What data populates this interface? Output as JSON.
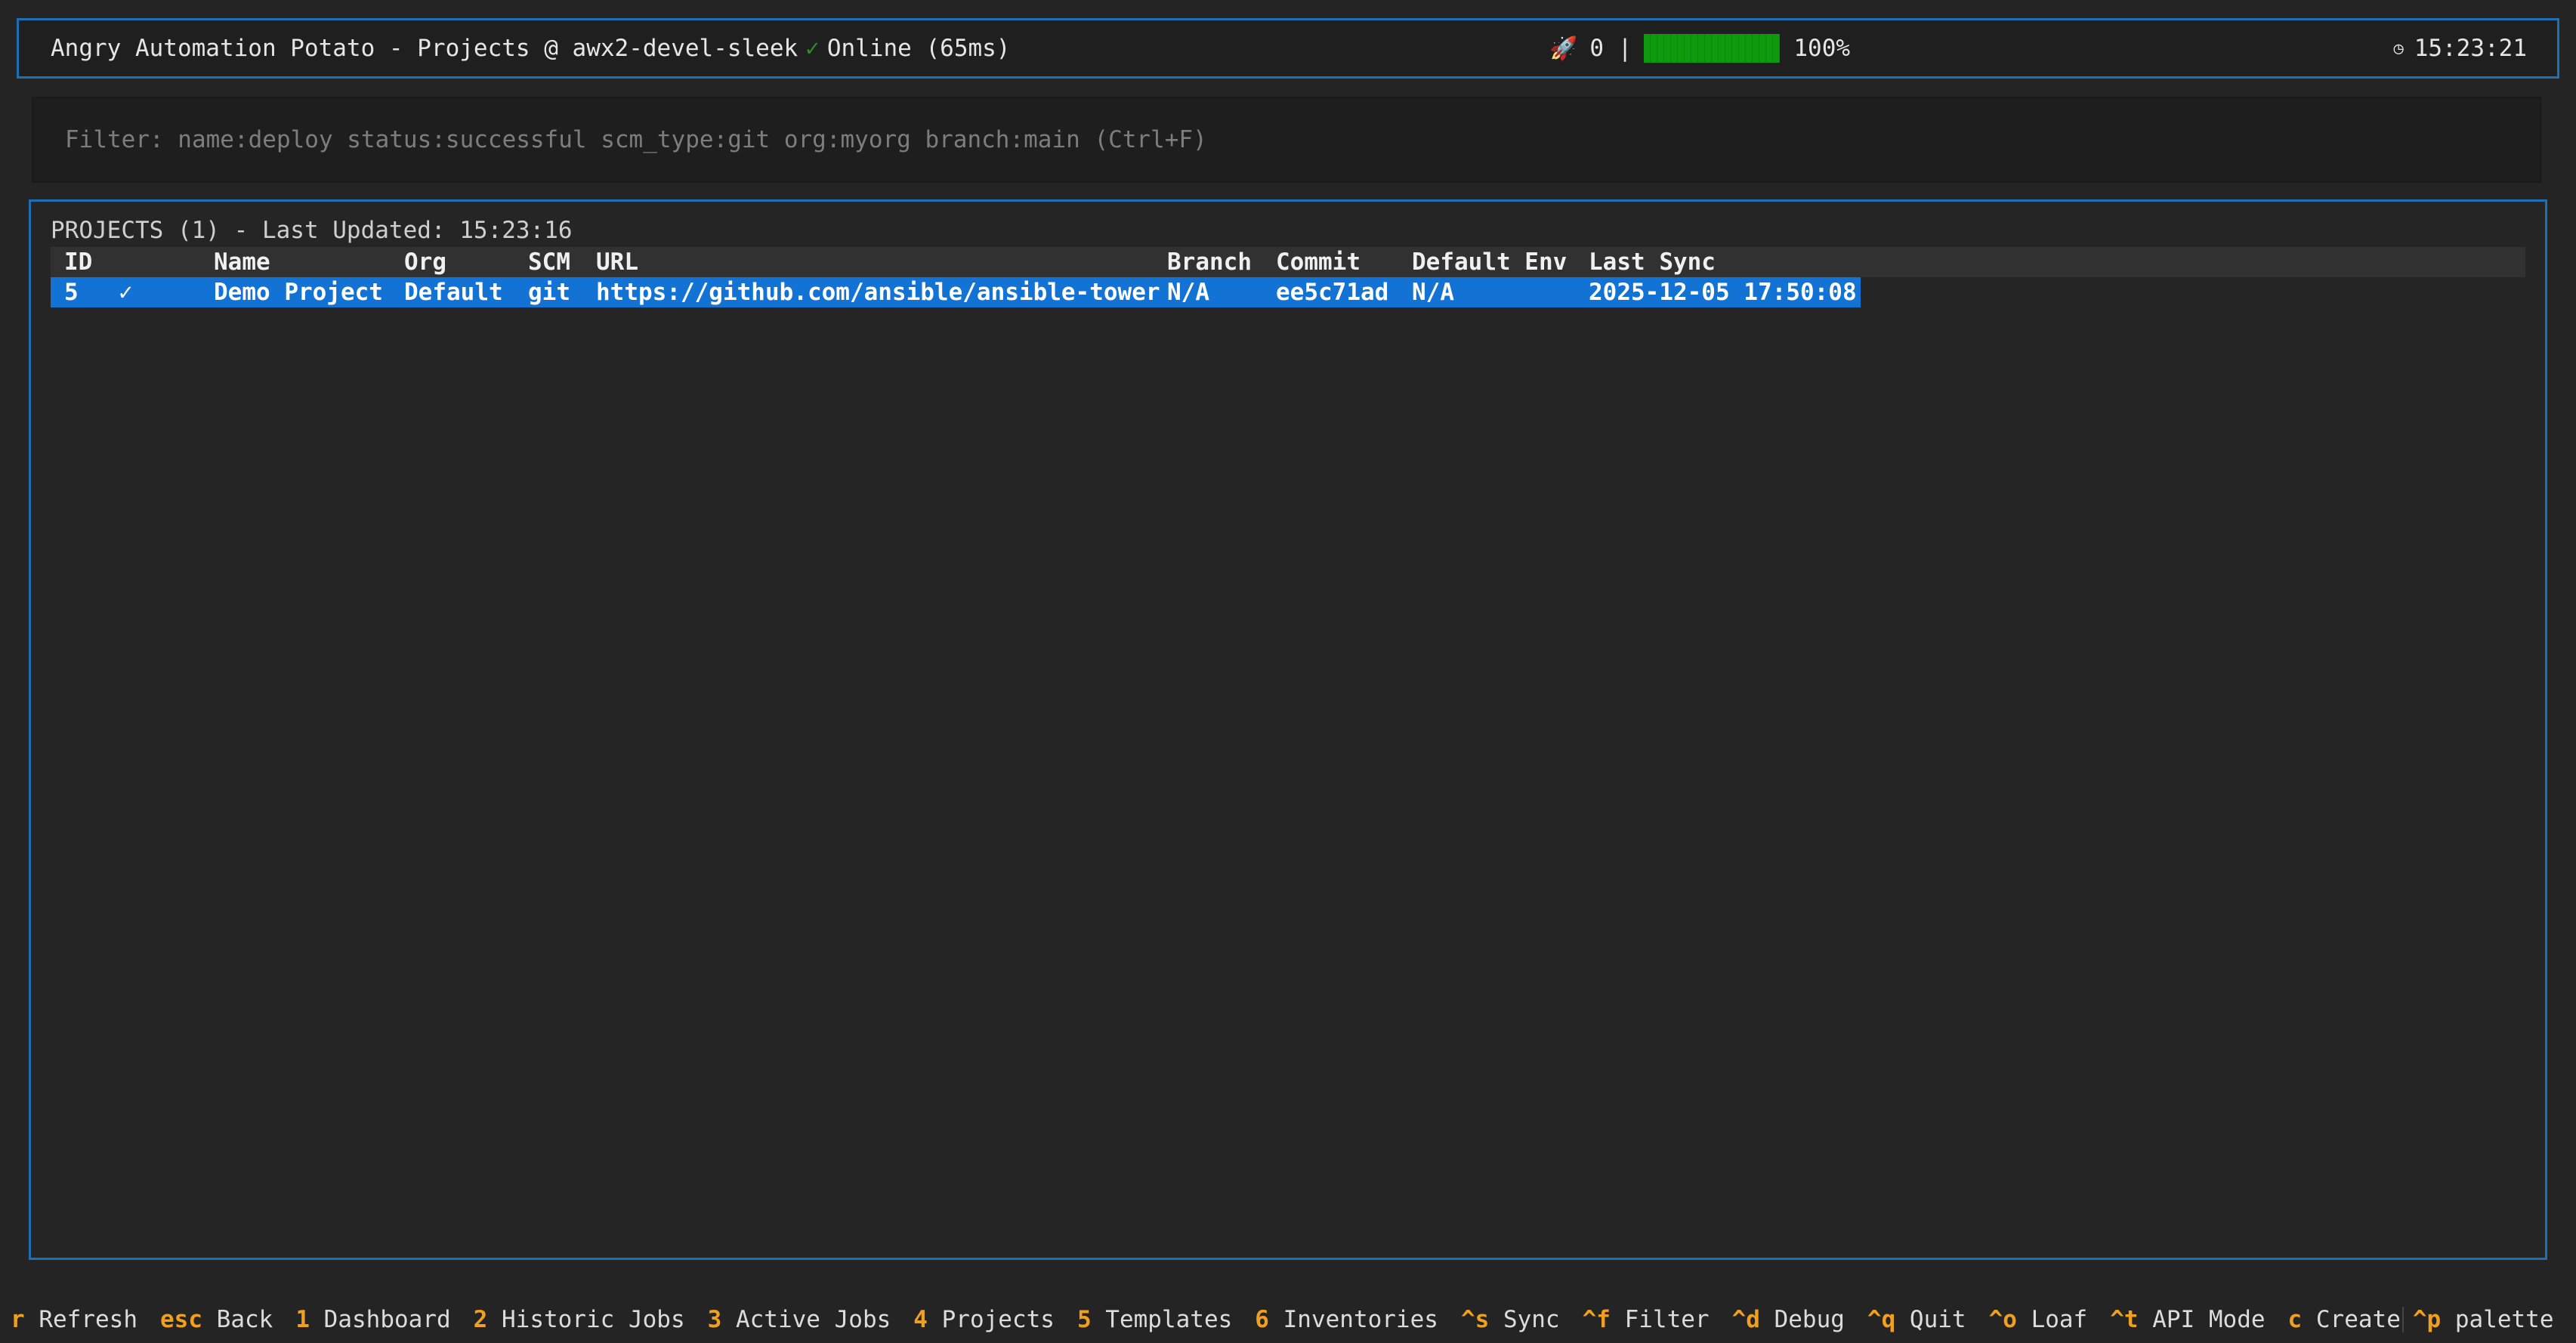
{
  "header": {
    "title": "Angry Automation Potato - Projects @ awx2-devel-sleek",
    "status_check": "✓",
    "status_text": "Online (65ms)",
    "rocket_count": "0",
    "separator": "|",
    "progress_percent_text": "100%",
    "progress_value": 1.0,
    "clock_icon": "clock-icon",
    "time": "15:23:21"
  },
  "filter": {
    "placeholder": "Filter: name:deploy status:successful scm_type:git org:myorg branch:main (Ctrl+F)"
  },
  "panel": {
    "title": "PROJECTS (1) - Last Updated: 15:23:16",
    "columns": {
      "id": "ID",
      "name": "Name",
      "org": "Org",
      "scm": "SCM",
      "url": "URL",
      "branch": "Branch",
      "commit": "Commit",
      "default_env": "Default Env",
      "last_sync": "Last Sync"
    },
    "rows": [
      {
        "id": "5",
        "status": "✓",
        "name": "Demo Project",
        "org": "Default",
        "scm": "git",
        "url": "https://github.com/ansible/ansible-tower",
        "branch": "N/A",
        "commit": "ee5c71ad",
        "default_env": "N/A",
        "last_sync": "2025-12-05 17:50:08"
      }
    ]
  },
  "footer": {
    "items": [
      {
        "key": "r",
        "label": "Refresh"
      },
      {
        "key": "esc",
        "label": "Back"
      },
      {
        "key": "1",
        "label": "Dashboard"
      },
      {
        "key": "2",
        "label": "Historic Jobs"
      },
      {
        "key": "3",
        "label": "Active Jobs"
      },
      {
        "key": "4",
        "label": "Projects"
      },
      {
        "key": "5",
        "label": "Templates"
      },
      {
        "key": "6",
        "label": "Inventories"
      },
      {
        "key": "^s",
        "label": "Sync"
      },
      {
        "key": "^f",
        "label": "Filter"
      },
      {
        "key": "^d",
        "label": "Debug"
      },
      {
        "key": "^q",
        "label": "Quit"
      },
      {
        "key": "^o",
        "label": "Loaf"
      },
      {
        "key": "^t",
        "label": "API Mode"
      },
      {
        "key": "c",
        "label": "Create"
      },
      {
        "key": "^p",
        "label": "palette"
      }
    ]
  },
  "colors": {
    "accent_border": "#1e6fb3",
    "selection": "#1273d4",
    "key_hint": "#f0a020",
    "online": "#2e8b2e",
    "progress": "#0a8a0a"
  }
}
